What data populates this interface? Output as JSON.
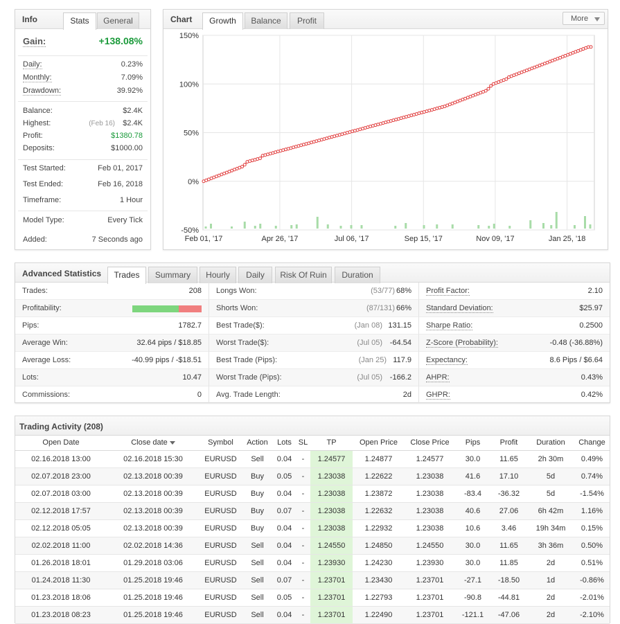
{
  "info": {
    "title": "Info",
    "tabs": [
      "Stats",
      "General"
    ],
    "gain_label": "Gain:",
    "gain_value": "+138.08%",
    "rows1": [
      {
        "label": "Daily:",
        "value": "0.23%",
        "dotted": true
      },
      {
        "label": "Monthly:",
        "value": "7.09%",
        "dotted": true
      },
      {
        "label": "Drawdown:",
        "value": "39.92%",
        "dotted": true
      }
    ],
    "balance_label": "Balance:",
    "balance_value": "$2.4K",
    "highest_label": "Highest:",
    "highest_date": "(Feb 16)",
    "highest_value": "$2.4K",
    "profit_label": "Profit:",
    "profit_value": "$1380.78",
    "deposits_label": "Deposits:",
    "deposits_value": "$1000.00",
    "rows3": [
      {
        "label": "Test Started:",
        "value": "Feb 01, 2017"
      },
      {
        "label": "Test Ended:",
        "value": "Feb 16, 2018"
      },
      {
        "label": "Timeframe:",
        "value": "1 Hour"
      }
    ],
    "rows4": [
      {
        "label": "Model Type:",
        "value": "Every Tick"
      },
      {
        "label": "Added:",
        "value": "7 Seconds ago"
      }
    ]
  },
  "chart_panel": {
    "title": "Chart",
    "tabs": [
      "Growth",
      "Balance",
      "Profit"
    ],
    "more_label": "More",
    "line_color": "#e03a3a",
    "bar_color": "#a8dca8"
  },
  "chart_data": {
    "type": "line",
    "y_ticks": [
      "150%",
      "100%",
      "50%",
      "0%",
      "-50%"
    ],
    "ylim": [
      -50,
      150
    ],
    "x_ticks": [
      "Feb 01, '17",
      "Apr 26, '17",
      "Jul 06, '17",
      "Sep 15, '17",
      "Nov 09, '17",
      "Jan 25, '18"
    ],
    "grid": true,
    "series": [
      {
        "values": [
          0,
          1,
          2,
          3,
          4,
          5,
          6,
          7,
          8,
          9,
          10,
          11,
          12,
          13,
          14,
          15,
          17,
          20,
          20.7,
          21.4,
          22.1,
          22.9,
          23.6,
          26.3,
          27,
          27.7,
          28.4,
          29.1,
          29.9,
          30.6,
          31.3,
          32,
          32.7,
          33.4,
          34.1,
          34.9,
          35.6,
          36.3,
          37,
          37.7,
          38.4,
          39.1,
          39.9,
          40.6,
          41.3,
          42,
          42.7,
          43.4,
          44.1,
          44.9,
          45.6,
          46.3,
          47,
          47.7,
          48.4,
          49.1,
          49.9,
          50.6,
          51.3,
          52,
          52.7,
          53.4,
          54.1,
          54.9,
          55.6,
          56.3,
          57,
          57.7,
          58.4,
          59.1,
          59.9,
          60.6,
          61.3,
          62,
          62.7,
          63.4,
          64.1,
          64.9,
          65.6,
          66.3,
          67,
          67.7,
          68.4,
          69.1,
          69.9,
          70.6,
          71.3,
          72,
          72.7,
          73.4,
          74.1,
          74.9,
          75.6,
          76.3,
          77,
          78,
          79,
          80,
          81,
          82,
          83,
          84,
          85,
          86,
          87,
          88,
          89,
          90,
          91,
          92,
          93,
          95,
          98,
          100,
          101,
          102,
          103,
          104,
          105,
          107,
          108,
          109,
          110,
          111,
          112,
          113,
          114,
          115,
          116,
          117,
          118,
          119,
          120,
          121,
          122,
          123,
          124,
          125,
          126,
          127,
          128,
          129,
          130,
          131,
          132,
          133,
          134,
          135,
          136,
          137,
          138,
          138.08
        ]
      }
    ],
    "bars": [
      3,
      0,
      7,
      0,
      0,
      0,
      0,
      0,
      0,
      0,
      3,
      0,
      0,
      0,
      0,
      10,
      0,
      0,
      0,
      4,
      0,
      7,
      0,
      0,
      0,
      0,
      0,
      4,
      0,
      0,
      0,
      0,
      0,
      5,
      0,
      6,
      0,
      0,
      0,
      0,
      0,
      0,
      0,
      17,
      0,
      0,
      0,
      6,
      0,
      0,
      0,
      0,
      4,
      0,
      0,
      0,
      5,
      0,
      0,
      0,
      5,
      0,
      0,
      0,
      0,
      0,
      0,
      0,
      0,
      0,
      0,
      0,
      0,
      4,
      0,
      0,
      0,
      8,
      0,
      0,
      0,
      0,
      0,
      0,
      5,
      0,
      0,
      0,
      0,
      6,
      0,
      0,
      0,
      0,
      0,
      6,
      0,
      0,
      0,
      0,
      0,
      0,
      0,
      0,
      0,
      5,
      0,
      0,
      0,
      4,
      0,
      7,
      0,
      0,
      0,
      0,
      0,
      4,
      0,
      0,
      0,
      0,
      0,
      0,
      0,
      12,
      0,
      0,
      0,
      0,
      8,
      0,
      0,
      5,
      0,
      24,
      0,
      0,
      0,
      0,
      0,
      0,
      5,
      0,
      0,
      0,
      18,
      0,
      6
    ]
  },
  "adv": {
    "title": "Advanced Statistics",
    "tabs": [
      "Trades",
      "Summary",
      "Hourly",
      "Daily",
      "Risk Of Ruin",
      "Duration"
    ],
    "col1": [
      {
        "label": "Trades:",
        "value": "208"
      },
      {
        "label": "Profitability:",
        "value": ""
      },
      {
        "label": "Pips:",
        "value": "1782.7"
      },
      {
        "label": "Average Win:",
        "value": "32.64 pips / $18.85"
      },
      {
        "label": "Average Loss:",
        "value": "-40.99 pips / -$18.51"
      },
      {
        "label": "Lots:",
        "value": "10.47"
      },
      {
        "label": "Commissions:",
        "value": "0"
      }
    ],
    "profitability": {
      "win_fraction": 0.67,
      "win_color": "#7ed67e",
      "loss_color": "#f07f7f"
    },
    "col2": [
      {
        "label": "Longs Won:",
        "meta": "(53/77)",
        "value": "68%"
      },
      {
        "label": "Shorts Won:",
        "meta": "(87/131)",
        "value": "66%"
      },
      {
        "label": "Best Trade($):",
        "meta": "(Jan 08)",
        "value": "131.15"
      },
      {
        "label": "Worst Trade($):",
        "meta": "(Jul 05)",
        "value": "-64.54"
      },
      {
        "label": "Best Trade (Pips):",
        "meta": "(Jan 25)",
        "value": "117.9"
      },
      {
        "label": "Worst Trade (Pips):",
        "meta": "(Jul 05)",
        "value": "-166.2"
      },
      {
        "label": "Avg. Trade Length:",
        "meta": "",
        "value": "2d"
      }
    ],
    "col3": [
      {
        "label": "Profit Factor:",
        "value": "2.10"
      },
      {
        "label": "Standard Deviation:",
        "value": "$25.97"
      },
      {
        "label": "Sharpe Ratio:",
        "value": "0.2500"
      },
      {
        "label": "Z-Score (Probability):",
        "value": "-0.48 (-36.88%)"
      },
      {
        "label": "Expectancy:",
        "value": "8.6 Pips / $6.64"
      },
      {
        "label": "AHPR:",
        "value": "0.43%"
      },
      {
        "label": "GHPR:",
        "value": "0.42%"
      }
    ]
  },
  "activity": {
    "title": "Trading Activity (208)",
    "columns": [
      "Open Date",
      "Close date",
      "Symbol",
      "Action",
      "Lots",
      "SL",
      "TP",
      "Open Price",
      "Close Price",
      "Pips",
      "Profit",
      "Duration",
      "Change"
    ],
    "rows": [
      [
        "02.16.2018 13:00",
        "02.16.2018 15:30",
        "EURUSD",
        "Sell",
        "0.04",
        "-",
        "1.24577",
        "1.24877",
        "1.24577",
        "30.0",
        "11.65",
        "2h 30m",
        "0.49%"
      ],
      [
        "02.07.2018 23:00",
        "02.13.2018 00:39",
        "EURUSD",
        "Buy",
        "0.05",
        "-",
        "1.23038",
        "1.22622",
        "1.23038",
        "41.6",
        "17.10",
        "5d",
        "0.74%"
      ],
      [
        "02.07.2018 03:00",
        "02.13.2018 00:39",
        "EURUSD",
        "Buy",
        "0.04",
        "-",
        "1.23038",
        "1.23872",
        "1.23038",
        "-83.4",
        "-36.32",
        "5d",
        "-1.54%"
      ],
      [
        "02.12.2018 17:57",
        "02.13.2018 00:39",
        "EURUSD",
        "Buy",
        "0.07",
        "-",
        "1.23038",
        "1.22632",
        "1.23038",
        "40.6",
        "27.06",
        "6h 42m",
        "1.16%"
      ],
      [
        "02.12.2018 05:05",
        "02.13.2018 00:39",
        "EURUSD",
        "Buy",
        "0.04",
        "-",
        "1.23038",
        "1.22932",
        "1.23038",
        "10.6",
        "3.46",
        "19h 34m",
        "0.15%"
      ],
      [
        "02.02.2018 11:00",
        "02.02.2018 14:36",
        "EURUSD",
        "Sell",
        "0.04",
        "-",
        "1.24550",
        "1.24850",
        "1.24550",
        "30.0",
        "11.65",
        "3h 36m",
        "0.50%"
      ],
      [
        "01.26.2018 18:01",
        "01.29.2018 03:06",
        "EURUSD",
        "Sell",
        "0.04",
        "-",
        "1.23930",
        "1.24230",
        "1.23930",
        "30.0",
        "11.85",
        "2d",
        "0.51%"
      ],
      [
        "01.24.2018 11:30",
        "01.25.2018 19:46",
        "EURUSD",
        "Sell",
        "0.07",
        "-",
        "1.23701",
        "1.23430",
        "1.23701",
        "-27.1",
        "-18.50",
        "1d",
        "-0.86%"
      ],
      [
        "01.23.2018 18:06",
        "01.25.2018 19:46",
        "EURUSD",
        "Sell",
        "0.05",
        "-",
        "1.23701",
        "1.22793",
        "1.23701",
        "-90.8",
        "-44.81",
        "2d",
        "-2.01%"
      ],
      [
        "01.23.2018 08:23",
        "01.25.2018 19:46",
        "EURUSD",
        "Sell",
        "0.04",
        "-",
        "1.23701",
        "1.22490",
        "1.23701",
        "-121.1",
        "-47.06",
        "2d",
        "-2.10%"
      ]
    ]
  }
}
